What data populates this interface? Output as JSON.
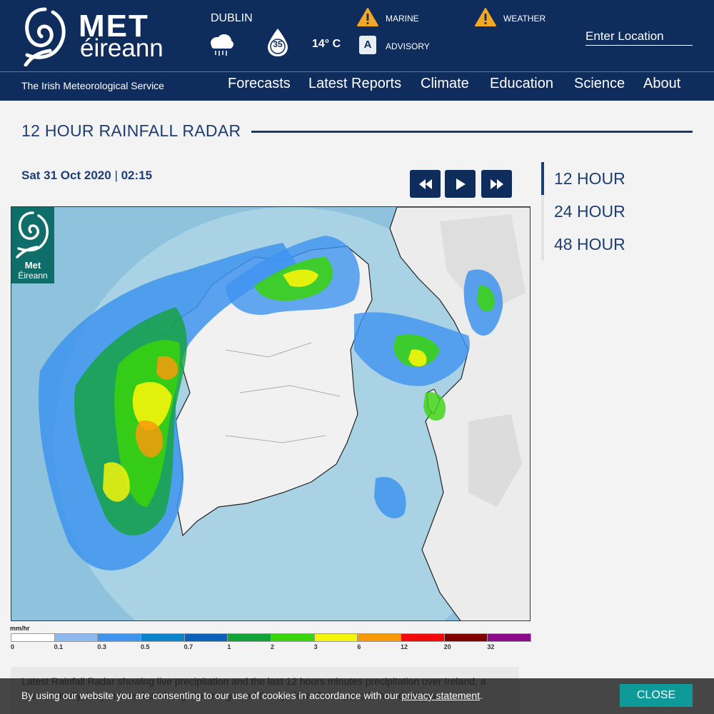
{
  "header": {
    "brand_met": "MET",
    "brand_eireann": "éireann",
    "tagline": "The Irish Meteorological Service",
    "city": "DUBLIN",
    "weather_icon": "rain-cloud-icon",
    "drop_value": "35",
    "temperature": "14° C",
    "warnings": {
      "marine_label": "MARINE",
      "advisory_label": "ADVISORY",
      "advisory_letter": "A",
      "weather_label": "WEATHER",
      "warning_color": "#f5a623"
    },
    "search": {
      "placeholder": "Enter Location"
    }
  },
  "nav": {
    "items": [
      {
        "label": "Forecasts"
      },
      {
        "label": "Latest Reports"
      },
      {
        "label": "Climate"
      },
      {
        "label": "Education"
      },
      {
        "label": "Science"
      },
      {
        "label": "About"
      }
    ]
  },
  "page": {
    "title": "12 HOUR RAINFALL RADAR"
  },
  "radar": {
    "date": "Sat 31 Oct 2020",
    "separator": "|",
    "time": "02:15",
    "controls": [
      "rewind-icon",
      "play-icon",
      "fast-forward-icon"
    ],
    "logo_met": "Met",
    "logo_eireann": "Éireann"
  },
  "side_tabs": [
    {
      "label": "12 HOUR",
      "active": true
    },
    {
      "label": "24 HOUR",
      "active": false
    },
    {
      "label": "48 HOUR",
      "active": false
    }
  ],
  "legend": {
    "unit": "mm/hr",
    "ticks": [
      "0",
      "0.1",
      "0.3",
      "0.5",
      "0.7",
      "1",
      "2",
      "3",
      "6",
      "12",
      "20",
      "32"
    ],
    "colors": [
      "#ffffff",
      "#8fb8f0",
      "#3f94f0",
      "#0a84c9",
      "#0a62b8",
      "#12a338",
      "#39d40c",
      "#f5f50a",
      "#f79a0a",
      "#f20a0a",
      "#800000",
      "#8a0a8a"
    ]
  },
  "description": {
    "text": "Latest Rainfall Radar showing live precipitation and the last 12 hours minutes precipitation over Ireland, a cross. Initially, they are red but change to orange and then yellow after a period, then disappear."
  },
  "cookie": {
    "text": "By using our website you are consenting to our use of cookies in accordance with our ",
    "link": "privacy statement",
    "suffix": ".",
    "close": "CLOSE"
  }
}
